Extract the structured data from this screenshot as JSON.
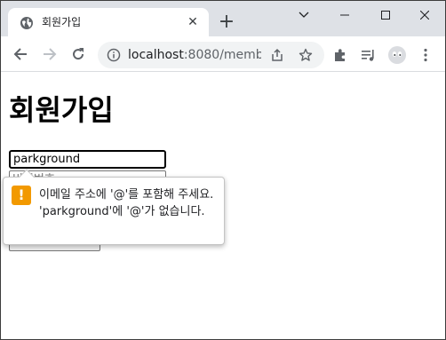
{
  "browser": {
    "tab": {
      "title": "회원가입",
      "favicon": "globe-icon",
      "close": "close-icon"
    },
    "new_tab": "+",
    "window_controls": [
      "chevron-down-icon",
      "minimize-icon",
      "maximize-icon",
      "close-icon"
    ],
    "toolbar": {
      "back": "arrow-left-icon",
      "forward": "arrow-right-icon",
      "reload": "reload-icon",
      "url_host": "localhost",
      "url_rest": ":8080/memb...",
      "actions": [
        "share-icon",
        "star-icon",
        "extensions-icon",
        "media-icon",
        "profile-avatar",
        "menu-kebab-icon"
      ]
    }
  },
  "page": {
    "title": "회원가입",
    "email": {
      "value": "parkground"
    },
    "password": {
      "placeholder": "비밀번호"
    },
    "submit_label": ""
  },
  "validation": {
    "icon": "warning-icon",
    "message": "이메일 주소에 '@'를 포함해 주세요. 'parkground'에 '@'가 없습니다.",
    "accent": "#f29900"
  }
}
